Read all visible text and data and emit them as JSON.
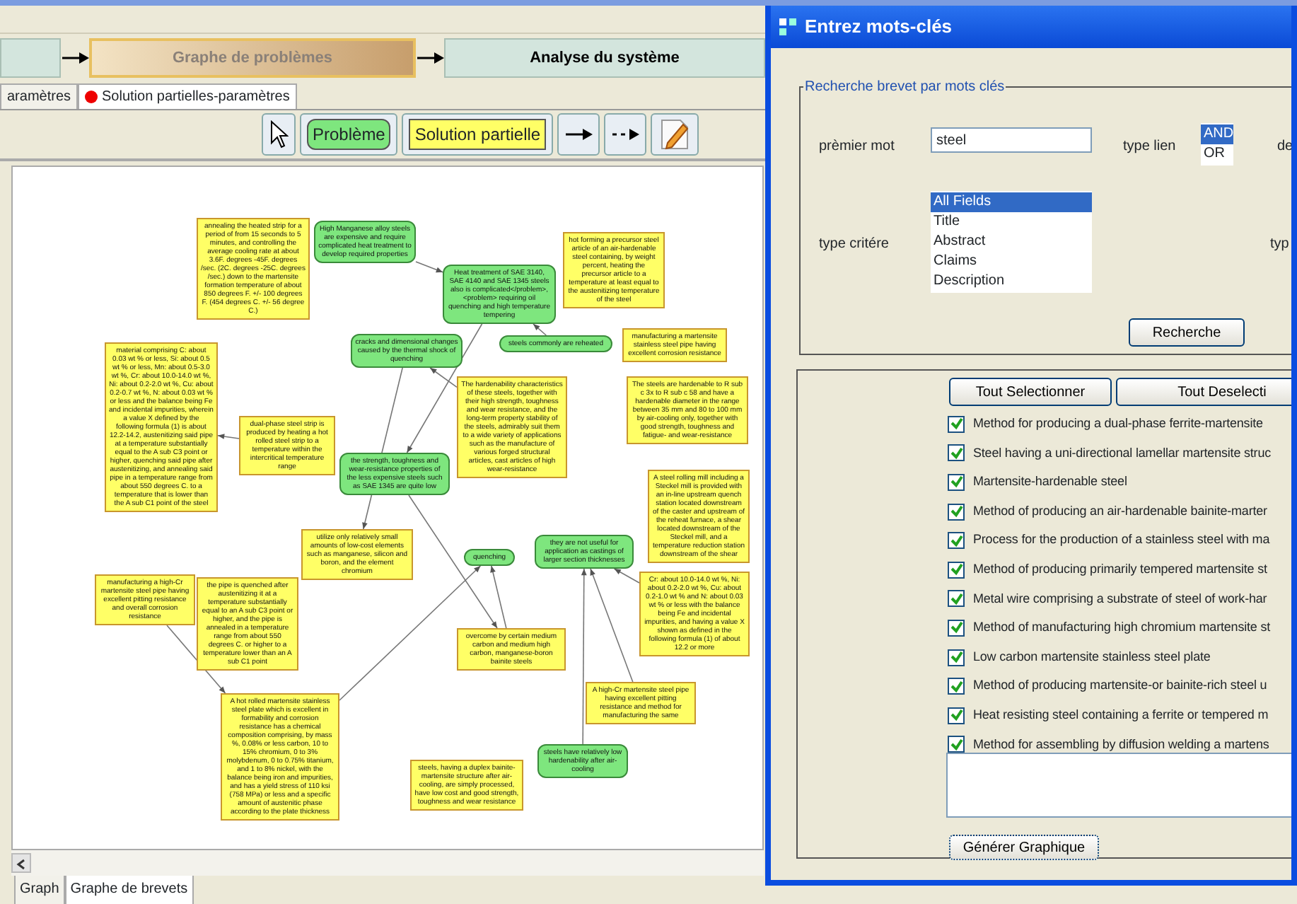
{
  "workflow": {
    "steps": [
      {
        "label": "Graphe de problèmes",
        "selected": true
      },
      {
        "label": "Analyse du système",
        "selected": false
      }
    ]
  },
  "tabs": [
    {
      "label": "aramètres",
      "selected": false,
      "dot": false
    },
    {
      "label": "Solution partielles-paramètres",
      "selected": true,
      "dot": true
    }
  ],
  "toolbar": [
    {
      "kind": "pointer"
    },
    {
      "kind": "problem",
      "label": "Problème"
    },
    {
      "kind": "solution",
      "label": "Solution partielle"
    },
    {
      "kind": "arrow"
    },
    {
      "kind": "dashed_arrow"
    },
    {
      "kind": "edit"
    }
  ],
  "graph": {
    "nodes": [
      {
        "kind": "solution",
        "text": "annealing the heated strip for a period of from 15 seconds to 5 minutes, and controlling the average cooling rate at about 3.6F. degrees -45F. degrees /sec. (2C. degrees -25C. degrees /sec.) down to the martensite formation temperature of about 850 degrees F. +/- 100 degrees F. (454 degrees C. +/- 56 degree C.)"
      },
      {
        "kind": "problem",
        "text": "High Manganese alloy steels are expensive and require complicated heat treatment to develop required properties"
      },
      {
        "kind": "problem",
        "text": "Heat treatment of SAE 3140, SAE 4140 and SAE 1345 steels also is complicated</problem>, <problem> requiring oil quenching and high temperature tempering"
      },
      {
        "kind": "solution",
        "text": "hot forming a precursor steel article of an air-hardenable steel containing, by weight percent, heating the precursor article to a temperature at least equal to the austenitizing temperature of the steel"
      },
      {
        "kind": "solution",
        "text": "material comprising C: about 0.03 wt % or less, Si: about 0.5 wt % or less, Mn: about 0.5-3.0 wt %, Cr: about 10.0-14.0 wt %, Ni: about 0.2-2.0 wt %, Cu: about 0.2-0.7 wt %, N: about 0.03 wt % or less and the balance being Fe and incidental impurities, wherein a value X defined by the following formula (1) is about 12.2-14.2, austenitizing said pipe at a temperature substantially equal to the A sub C3 point or higher, quenching said pipe after austenitizing, and annealing said pipe in a temperature range from about 550 degrees C. to a temperature that is lower than the A sub C1 point of the steel"
      },
      {
        "kind": "problem",
        "text": "cracks and dimensional changes caused by the thermal shock of quenching"
      },
      {
        "kind": "problem",
        "text": "steels commonly are reheated"
      },
      {
        "kind": "solution",
        "text": "manufacturing a martensite stainless steel pipe having excellent corrosion resistance"
      },
      {
        "kind": "solution",
        "text": "dual-phase steel strip is produced by heating a hot rolled steel strip to a temperature within the intercritical temperature range"
      },
      {
        "kind": "problem",
        "text": "the strength, toughness and wear-resistance properties of the less expensive steels such as SAE 1345 are quite low"
      },
      {
        "kind": "solution",
        "text": "The hardenability characteristics of these steels, together with their high strength, toughness and wear resistance, and the long-term property stability of the steels, admirably suit them to a wide variety of applications such as the manufacture of various forged structural articles, cast articles of high wear-resistance"
      },
      {
        "kind": "solution",
        "text": "The steels are hardenable to R sub c 3x to R sub c 58 and have a hardenable diameter in the range between 35 mm and 80 to 100 mm by air-cooling only, together with good strength, toughness and fatigue- and wear-resistance"
      },
      {
        "kind": "solution",
        "text": "utilize only relatively small amounts of low-cost elements such as manganese, silicon and boron, and the element chromium"
      },
      {
        "kind": "problem",
        "text": "quenching"
      },
      {
        "kind": "problem",
        "text": "they are not useful for application as castings of larger section thicknesses"
      },
      {
        "kind": "solution",
        "text": "A steel rolling mill including a Steckel mill is provided with an in-line upstream quench station located downstream of the caster and upstream of the reheat furnace, a shear located downstream of the Steckel mill, and a temperature reduction station downstream of the shear"
      },
      {
        "kind": "solution",
        "text": "manufacturing a high-Cr martensite steel pipe having excellent pitting resistance and overall corrosion resistance"
      },
      {
        "kind": "solution",
        "text": "the pipe is quenched after austenitizing it at a temperature substantially equal to an A sub C3 point or higher, and the pipe is annealed in a temperature range from about 550 degrees C. or higher to a temperature lower than an A sub C1 point"
      },
      {
        "kind": "solution",
        "text": "overcome by certain medium carbon and medium high carbon, manganese-boron bainite steels"
      },
      {
        "kind": "solution",
        "text": "Cr: about 10.0-14.0 wt %, Ni: about 0.2-2.0 wt %, Cu: about 0.2-1.0 wt % and N: about 0.03 wt % or less with the balance being Fe and incidental impurities, and having a value X shown as defined in the following formula (1) of about 12.2 or more"
      },
      {
        "kind": "solution",
        "text": "A hot rolled martensite stainless steel plate which is excellent in formability and corrosion resistance has a chemical composition comprising, by mass %, 0.08% or less carbon, 10 to 15% chromium, 0 to 3% molybdenum, 0 to 0.75% titanium, and 1 to 8% nickel, with the balance being iron and impurities, and has a yield stress of 110 ksi (758 MPa) or less and a specific amount of austenitic phase according to the plate thickness"
      },
      {
        "kind": "solution",
        "text": "A high-Cr martensite steel pipe having excellent pitting resistance and method for manufacturing the same"
      },
      {
        "kind": "solution",
        "text": "steels, having a duplex bainite-martensite structure after air-cooling, are simply processed, have low cost and good strength, toughness and wear resistance"
      },
      {
        "kind": "problem",
        "text": "steels have relatively low hardenability after air-cooling"
      }
    ]
  },
  "bottom_tabs": [
    {
      "label": "Graph",
      "selected": false
    },
    {
      "label": "Graphe de brevets",
      "selected": true
    }
  ],
  "dialog": {
    "title": "Entrez mots-clés",
    "legend": "Recherche brevet par mots clés",
    "first_word_label": "prèmier mot",
    "first_word": "steel",
    "link_label": "type lien",
    "link_options": [
      {
        "label": "AND",
        "selected": true
      },
      {
        "label": "OR",
        "selected": false
      }
    ],
    "second_word_label": "de",
    "criteria_label": "type critére",
    "criteria": [
      {
        "label": "All Fields",
        "selected": true
      },
      {
        "label": "Title",
        "selected": false
      },
      {
        "label": "Abstract",
        "selected": false
      },
      {
        "label": "Claims",
        "selected": false
      },
      {
        "label": "Description",
        "selected": false
      }
    ],
    "second_criteria_label": "typ",
    "search_button": "Recherche",
    "select_all": "Tout Selectionner",
    "deselect_all": "Tout Deselecti",
    "results": [
      {
        "label": "Method for producing a dual-phase ferrite-martensite",
        "checked": true
      },
      {
        "label": "Steel having a uni-directional lamellar martensite struc",
        "checked": true
      },
      {
        "label": "Martensite-hardenable steel",
        "checked": true
      },
      {
        "label": "Method of producing an air-hardenable bainite-marter",
        "checked": true
      },
      {
        "label": "Process for the production of a stainless steel with ma",
        "checked": true
      },
      {
        "label": "Method of producing primarily tempered martensite st",
        "checked": true
      },
      {
        "label": "Metal wire comprising a substrate of steel of work-har",
        "checked": true
      },
      {
        "label": "Method of manufacturing high chromium martensite st",
        "checked": true
      },
      {
        "label": "Low carbon martensite stainless steel plate",
        "checked": true
      },
      {
        "label": "Method of producing martensite-or bainite-rich steel u",
        "checked": true
      },
      {
        "label": "Heat resisting steel containing a ferrite or tempered m",
        "checked": true
      },
      {
        "label": "Method for assembling by diffusion welding a martens",
        "checked": true
      }
    ],
    "generate_button": "Générer Graphique"
  }
}
